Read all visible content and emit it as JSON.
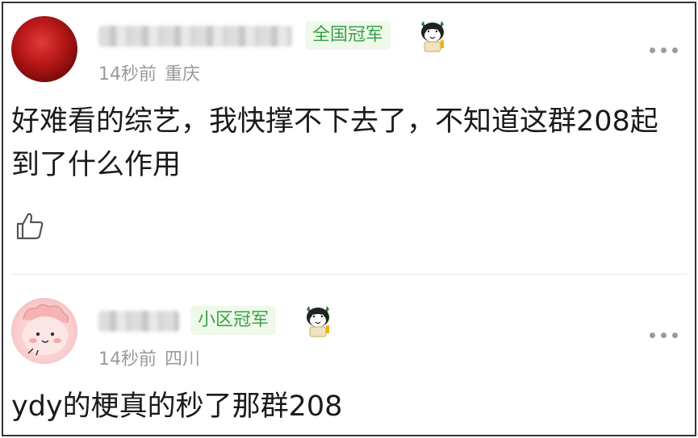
{
  "comments": [
    {
      "username": "",
      "badge": "全国冠军",
      "time": "14秒前",
      "location": "重庆",
      "text": "好难看的综艺，我快撑不下去了，不知道这群208起到了什么作用",
      "avatar_icon": "red-abstract-avatar",
      "mascot_icon": "cat-mascot-icon"
    },
    {
      "username": "",
      "badge": "小区冠军",
      "time": "14秒前",
      "location": "四川",
      "text": "ydy的梗真的秒了那群208",
      "avatar_icon": "pink-bunny-avatar",
      "mascot_icon": "cat-mascot-icon"
    }
  ],
  "colors": {
    "badge_bg": "#eef9ea",
    "badge_text": "#3aa14a",
    "meta_text": "#9a9a9a",
    "body_text": "#1a1a1a"
  }
}
